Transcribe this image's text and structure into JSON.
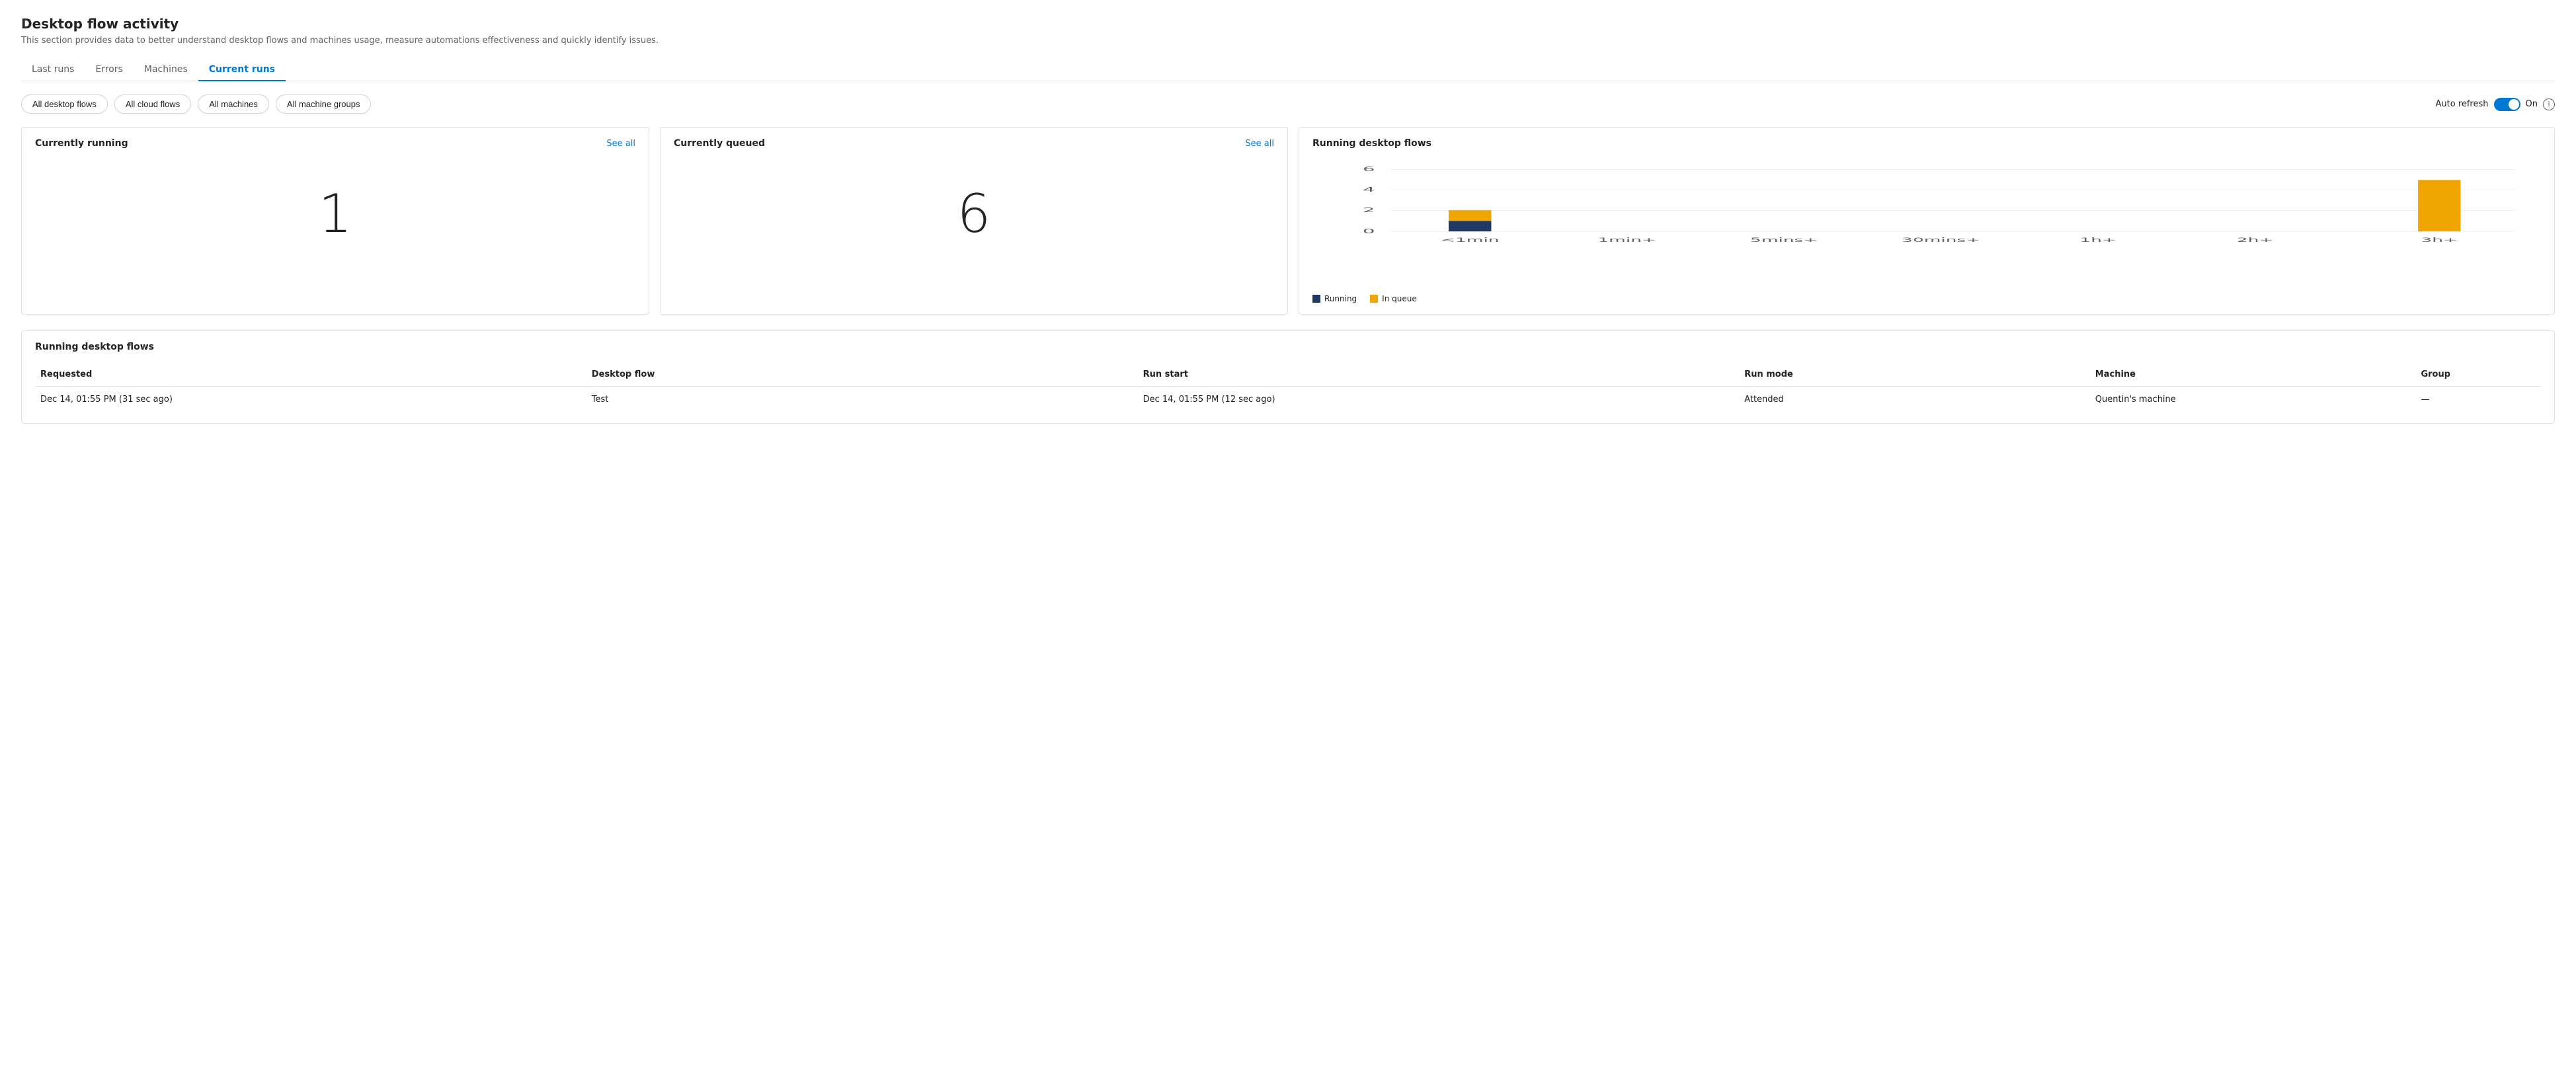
{
  "page": {
    "title": "Desktop flow activity",
    "subtitle": "This section provides data to better understand desktop flows and machines usage, measure automations effectiveness and quickly identify issues."
  },
  "tabs": [
    {
      "id": "last-runs",
      "label": "Last runs",
      "active": false
    },
    {
      "id": "errors",
      "label": "Errors",
      "active": false
    },
    {
      "id": "machines",
      "label": "Machines",
      "active": false
    },
    {
      "id": "current-runs",
      "label": "Current runs",
      "active": true
    }
  ],
  "filters": [
    {
      "id": "all-desktop-flows",
      "label": "All desktop flows"
    },
    {
      "id": "all-cloud-flows",
      "label": "All cloud flows"
    },
    {
      "id": "all-machines",
      "label": "All machines"
    },
    {
      "id": "all-machine-groups",
      "label": "All machine groups"
    }
  ],
  "auto_refresh": {
    "label": "Auto refresh",
    "status": "On",
    "enabled": true
  },
  "currently_running": {
    "title": "Currently running",
    "see_all": "See all",
    "value": "1"
  },
  "currently_queued": {
    "title": "Currently queued",
    "see_all": "See all",
    "value": "6"
  },
  "running_desktop_flows_chart": {
    "title": "Running desktop flows",
    "x_labels": [
      "<1min",
      "1min+",
      "5mins+",
      "30mins+",
      "1h+",
      "2h+",
      "3h+"
    ],
    "y_labels": [
      "0",
      "2",
      "4",
      "6"
    ],
    "bars": [
      {
        "label": "<1min",
        "running": 1,
        "in_queue": 1
      },
      {
        "label": "1min+",
        "running": 0,
        "in_queue": 0
      },
      {
        "label": "5mins+",
        "running": 0,
        "in_queue": 0
      },
      {
        "label": "30mins+",
        "running": 0,
        "in_queue": 0
      },
      {
        "label": "1h+",
        "running": 0,
        "in_queue": 0
      },
      {
        "label": "2h+",
        "running": 0,
        "in_queue": 0
      },
      {
        "label": "3h+",
        "running": 0,
        "in_queue": 5
      }
    ],
    "legend": [
      {
        "id": "running",
        "label": "Running",
        "color": "#1f3864"
      },
      {
        "id": "in_queue",
        "label": "In queue",
        "color": "#f0a500"
      }
    ]
  },
  "running_table": {
    "title": "Running desktop flows",
    "columns": [
      {
        "id": "requested",
        "label": "Requested"
      },
      {
        "id": "desktop_flow",
        "label": "Desktop flow"
      },
      {
        "id": "run_start",
        "label": "Run start"
      },
      {
        "id": "run_mode",
        "label": "Run mode"
      },
      {
        "id": "machine",
        "label": "Machine"
      },
      {
        "id": "group",
        "label": "Group"
      }
    ],
    "rows": [
      {
        "requested": "Dec 14, 01:55 PM (31 sec ago)",
        "desktop_flow": "Test",
        "run_start": "Dec 14, 01:55 PM (12 sec ago)",
        "run_mode": "Attended",
        "machine": "Quentin's machine",
        "group": "—"
      }
    ]
  }
}
